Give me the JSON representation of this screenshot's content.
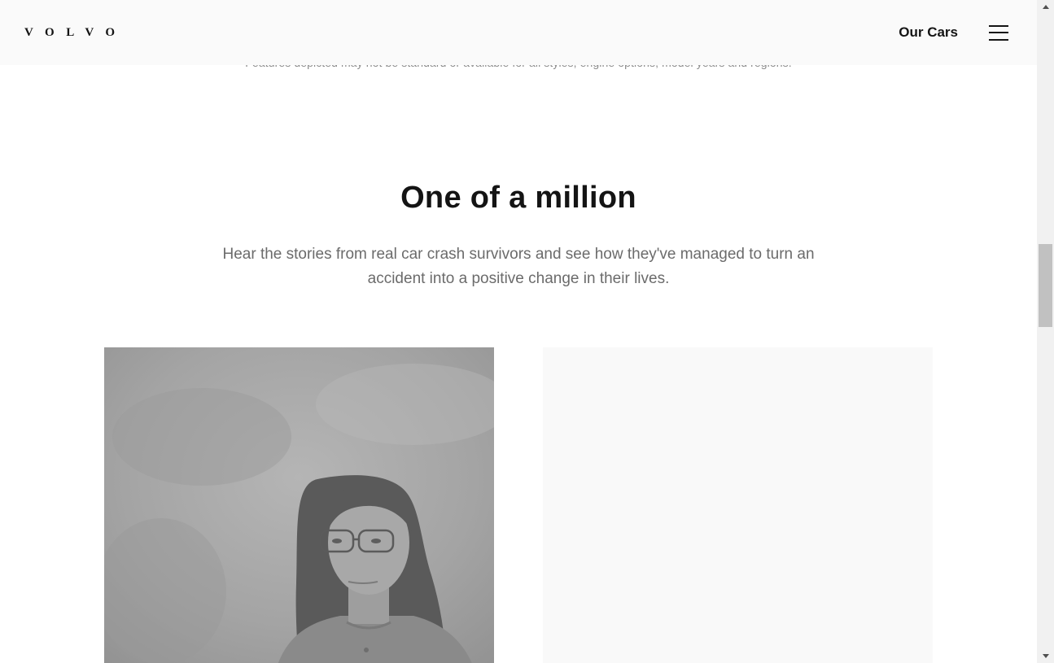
{
  "header": {
    "logo": "VOLVO",
    "nav_link": "Our Cars",
    "menu_icon": "hamburger-menu-icon"
  },
  "disclaimer": "Features depicted may not be standard or available for all styles, engine options, model years and regions.",
  "section": {
    "title": "One of a million",
    "description": "Hear the stories from real car crash survivors and see how they've managed to turn an accident into a positive change in their lives."
  },
  "cards": [
    {
      "image": "portrait-photo-woman-glasses"
    },
    {
      "image": "placeholder-image"
    }
  ],
  "colors": {
    "header_bg": "#fafafa",
    "text_dark": "#141414",
    "text_muted": "#6b6b6b",
    "photo_gray": "#a6a6a6",
    "card_placeholder": "#f9f9f9"
  }
}
